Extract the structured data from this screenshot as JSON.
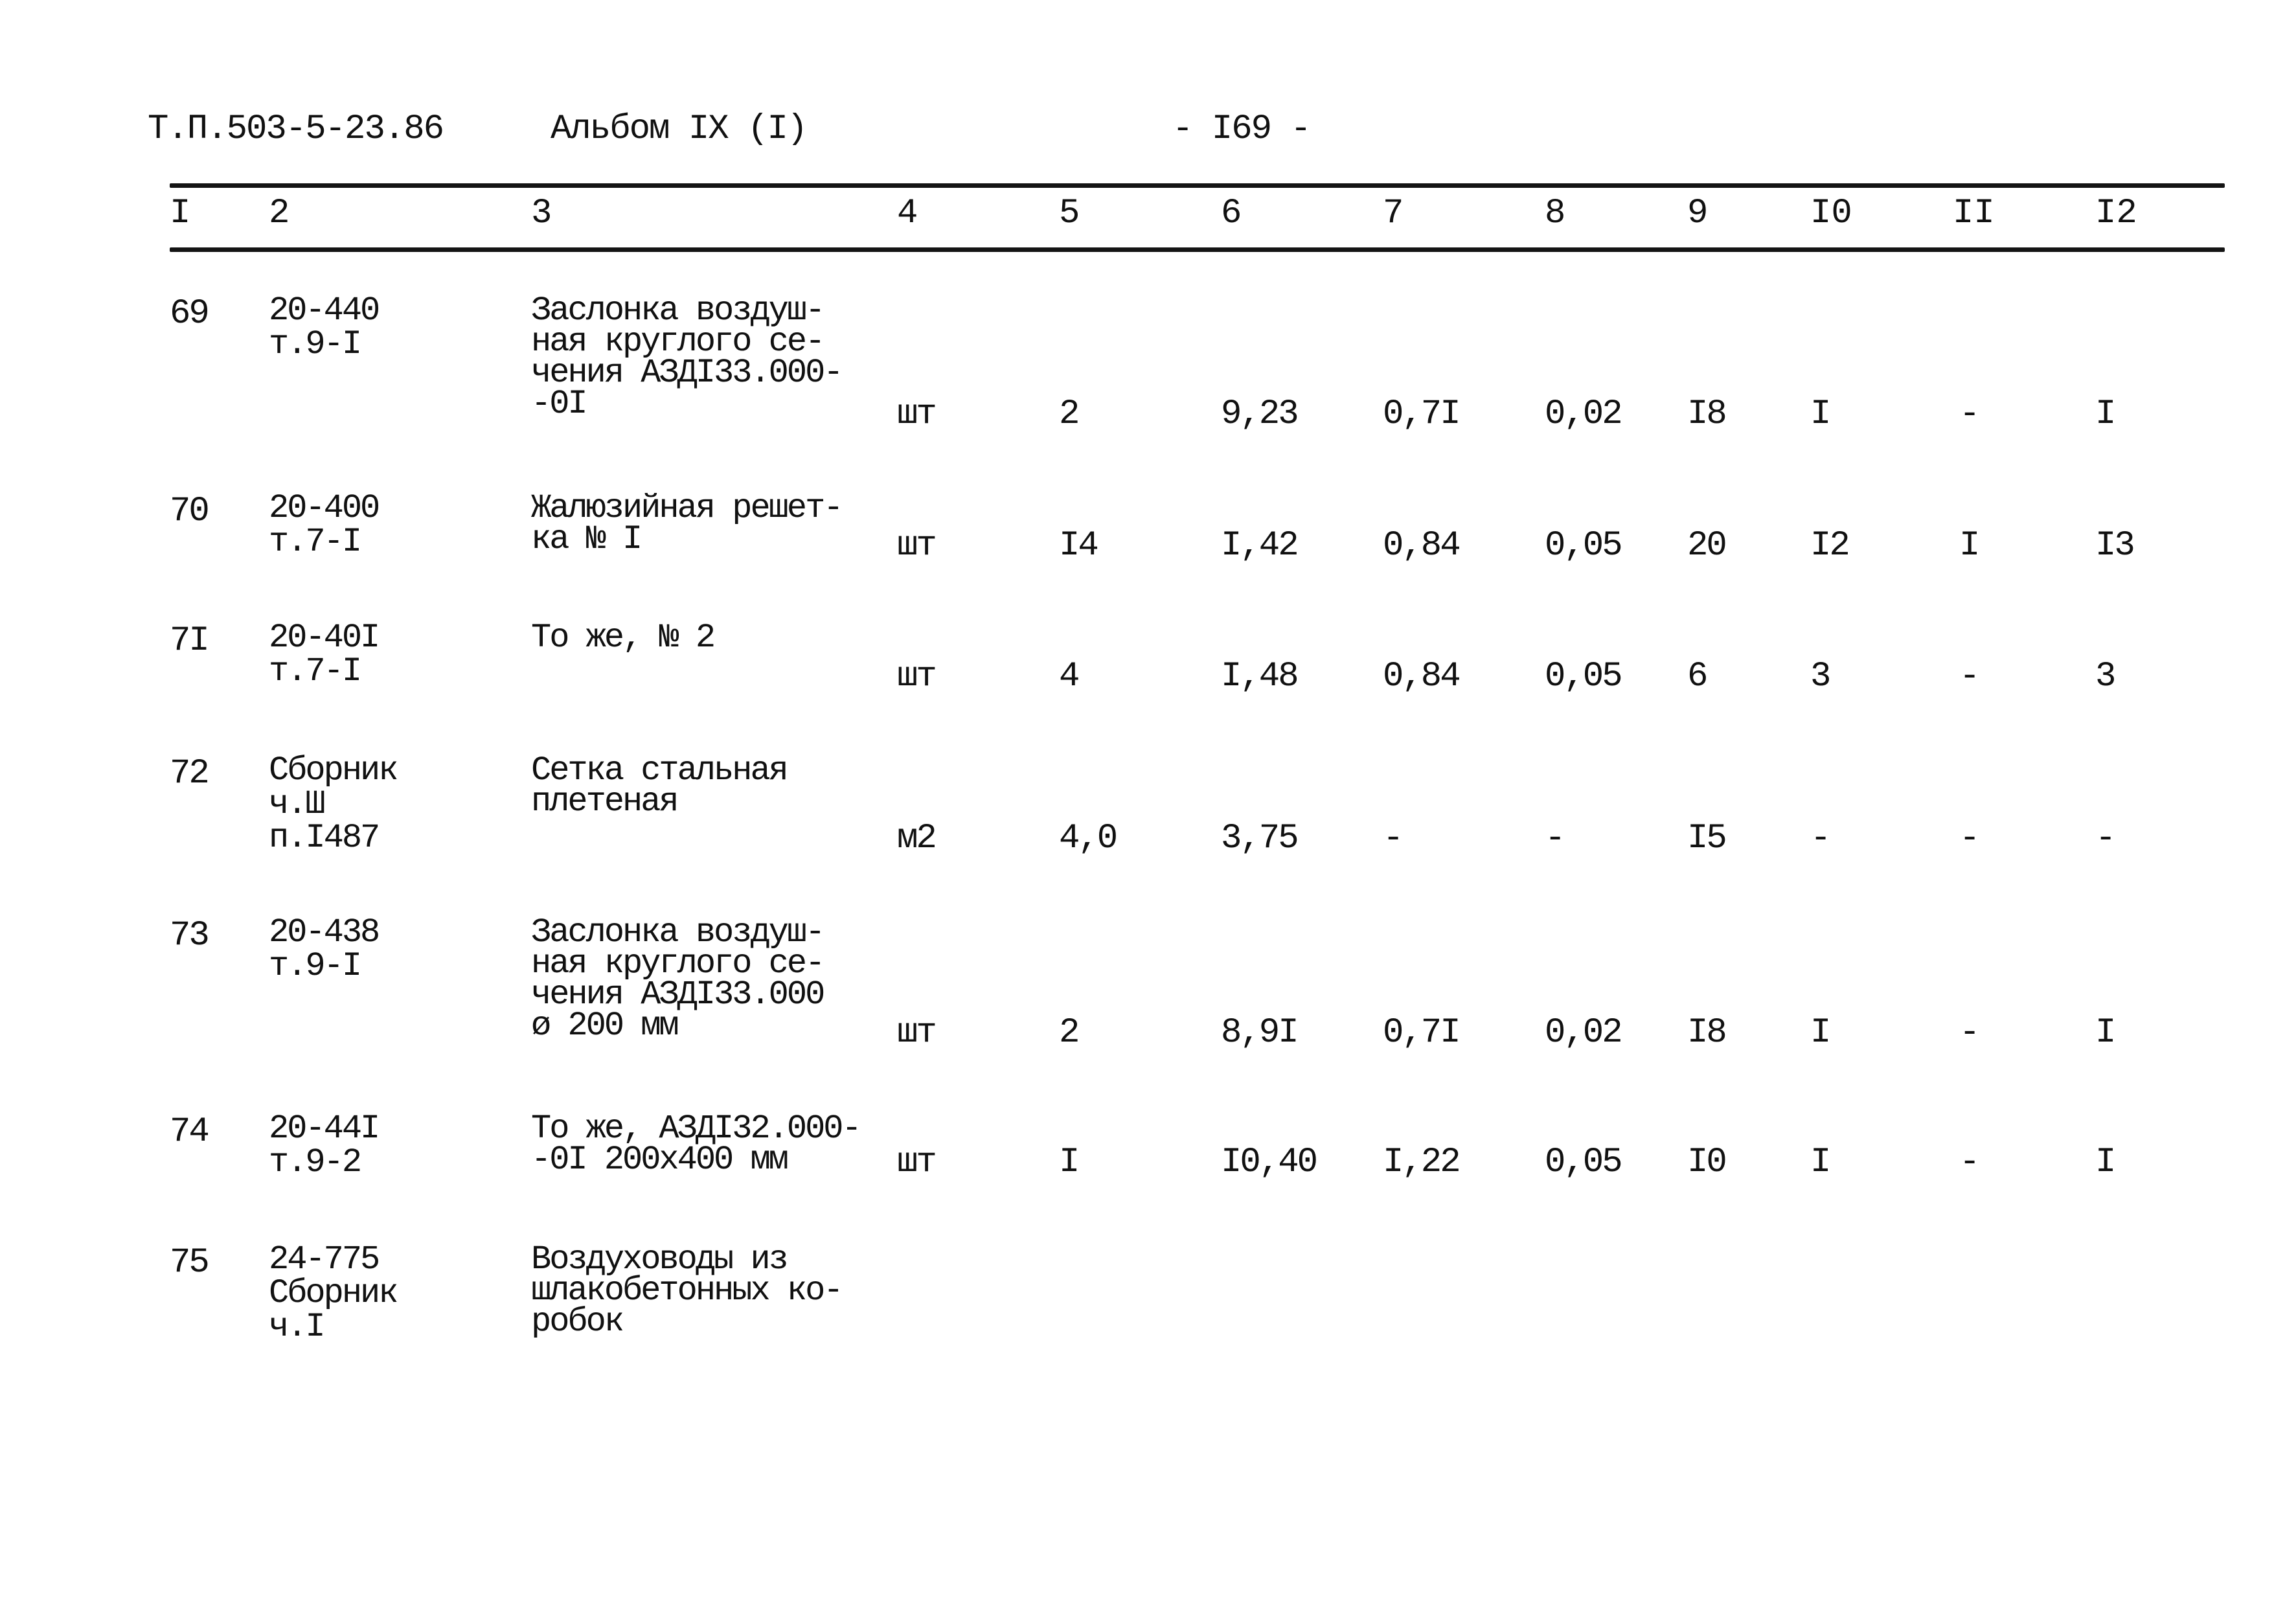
{
  "header": {
    "doc_code": "Т.П.503-5-23.86",
    "album": "Альбом IX (I)",
    "page": "- I69 -"
  },
  "table": {
    "columns": [
      "I",
      "2",
      "3",
      "4",
      "5",
      "6",
      "7",
      "8",
      "9",
      "I0",
      "II",
      "I2"
    ],
    "rows": [
      {
        "num": "69",
        "ref": [
          "20-440",
          "т.9-I"
        ],
        "desc": [
          "Заслонка воздуш-",
          "ная круглого се-",
          "чения АЗДI33.000-",
          "-0I"
        ],
        "unit": "шт",
        "c5": "2",
        "c6": "9,23",
        "c7": "0,7I",
        "c8": "0,02",
        "c9": "I8",
        "c10": "I",
        "c11": "-",
        "c12": "I"
      },
      {
        "num": "70",
        "ref": [
          "20-400",
          "т.7-I"
        ],
        "desc": [
          "Жалюзийная решет-",
          "ка № I"
        ],
        "unit": "шт",
        "c5": "I4",
        "c6": "I,42",
        "c7": "0,84",
        "c8": "0,05",
        "c9": "20",
        "c10": "I2",
        "c11": "I",
        "c12": "I3"
      },
      {
        "num": "7I",
        "ref": [
          "20-40I",
          "т.7-I"
        ],
        "desc": [
          "То же, № 2"
        ],
        "unit": "шт",
        "c5": "4",
        "c6": "I,48",
        "c7": "0,84",
        "c8": "0,05",
        "c9": "6",
        "c10": "3",
        "c11": "-",
        "c12": "3"
      },
      {
        "num": "72",
        "ref": [
          "Сборник",
          "ч.Ш",
          "п.I487"
        ],
        "desc": [
          "Сетка стальная",
          "плетеная"
        ],
        "unit": "м2",
        "c5": "4,0",
        "c6": "3,75",
        "c7": "-",
        "c8": "-",
        "c9": "I5",
        "c10": "-",
        "c11": "-",
        "c12": "-"
      },
      {
        "num": "73",
        "ref": [
          "20-438",
          "т.9-I"
        ],
        "desc": [
          "Заслонка воздуш-",
          "ная круглого се-",
          "чения АЗДI33.000",
          "ø 200 мм"
        ],
        "unit": "шт",
        "c5": "2",
        "c6": "8,9I",
        "c7": "0,7I",
        "c8": "0,02",
        "c9": "I8",
        "c10": "I",
        "c11": "-",
        "c12": "I"
      },
      {
        "num": "74",
        "ref": [
          "20-44I",
          "т.9-2"
        ],
        "desc": [
          "То же, АЗДI32.000-",
          "-0I 200х400 мм"
        ],
        "unit": "шт",
        "c5": "I",
        "c6": "I0,40",
        "c7": "I,22",
        "c8": "0,05",
        "c9": "I0",
        "c10": "I",
        "c11": "-",
        "c12": "I"
      },
      {
        "num": "75",
        "ref": [
          "24-775",
          "Сборник",
          "ч.I"
        ],
        "desc": [
          "Воздуховоды из",
          "шлакобетонных ко-",
          "робок"
        ],
        "unit": "",
        "c5": "",
        "c6": "",
        "c7": "",
        "c8": "",
        "c9": "",
        "c10": "",
        "c11": "",
        "c12": ""
      }
    ]
  }
}
